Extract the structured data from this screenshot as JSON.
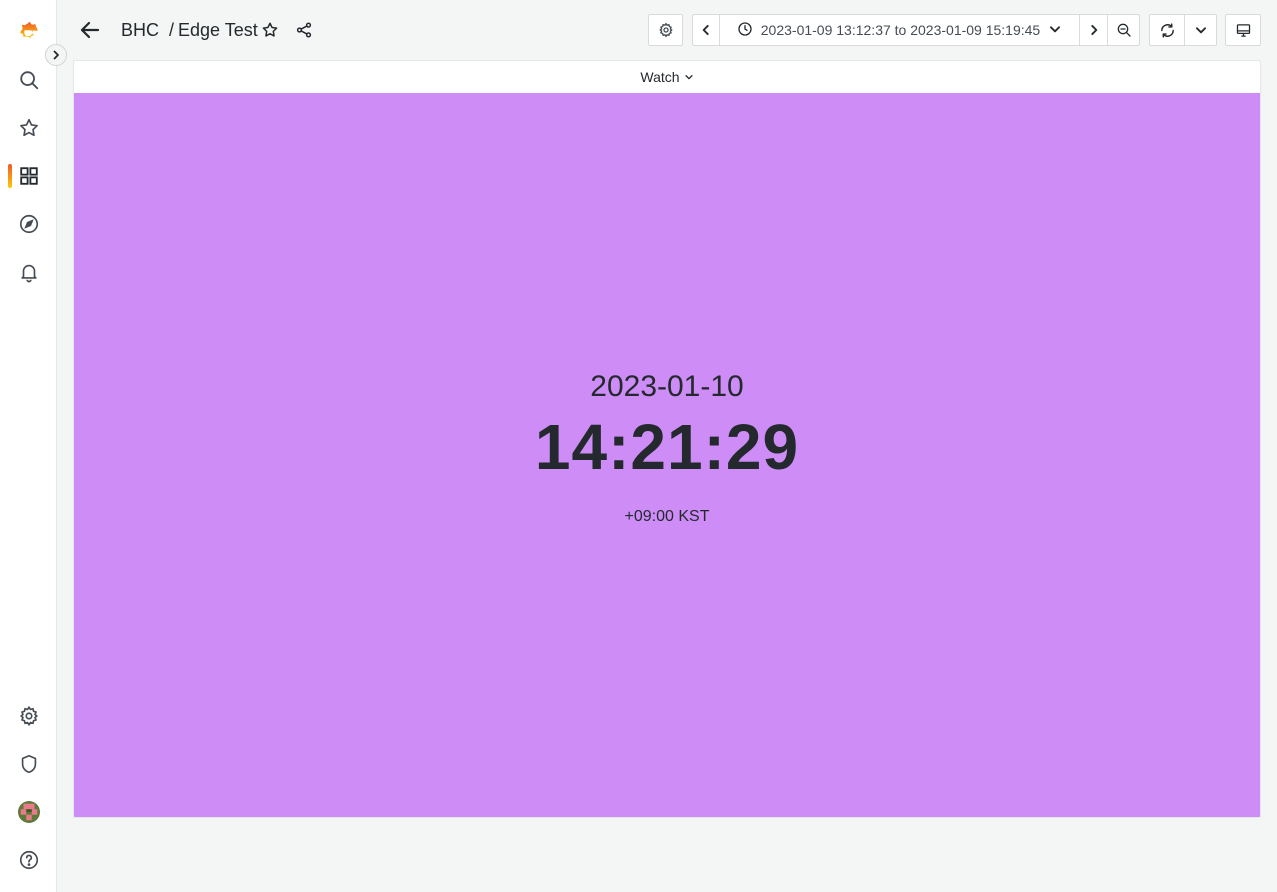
{
  "breadcrumb": {
    "folder": "BHC",
    "separator": "/",
    "title": "Edge Test"
  },
  "time_range": {
    "label": "2023-01-09 13:12:37 to 2023-01-09 15:19:45"
  },
  "panel": {
    "title": "Watch",
    "background_color": "#cd8cf6",
    "date": "2023-01-10",
    "time": "14:21:29",
    "timezone": "+09:00 KST"
  },
  "sidebar": {
    "items": [
      {
        "name": "home-logo-icon"
      },
      {
        "name": "search-icon"
      },
      {
        "name": "starred-icon"
      },
      {
        "name": "dashboards-icon",
        "active": true
      },
      {
        "name": "explore-icon"
      },
      {
        "name": "alerting-icon"
      },
      {
        "name": "configuration-icon"
      },
      {
        "name": "server-admin-shield-icon"
      },
      {
        "name": "user-avatar"
      },
      {
        "name": "help-icon"
      }
    ]
  },
  "colors": {
    "accent_gradient_start": "#f05a28",
    "accent_gradient_end": "#fbca0a",
    "panel_bg": "#cd8cf6",
    "page_bg": "#f4f5f5"
  }
}
